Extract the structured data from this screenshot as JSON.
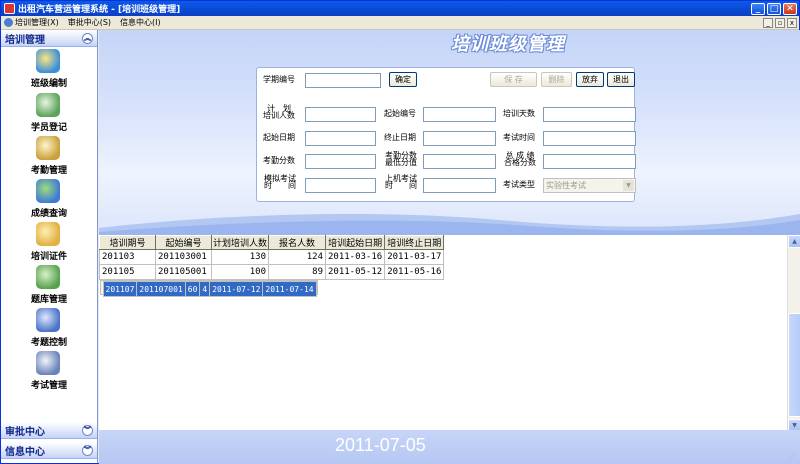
{
  "window": {
    "title": "出租汽车营运管理系统 - [培训班级管理]",
    "buttons": {
      "minimize": "_",
      "maximize": "□",
      "close": "✕"
    }
  },
  "menu": [
    {
      "label": "培训管理(X)"
    },
    {
      "label": "审批中心(S)"
    },
    {
      "label": "信息中心(I)"
    }
  ],
  "nav": {
    "header": "培训管理",
    "items": [
      {
        "label": "班级编制",
        "icon": "class-board-icon",
        "color": "#3b8fd9"
      },
      {
        "label": "学员登记",
        "icon": "student-register-icon",
        "color": "#5aa35a"
      },
      {
        "label": "考勤管理",
        "icon": "attendance-pen-icon",
        "color": "#c9a13c"
      },
      {
        "label": "成绩查询",
        "icon": "score-query-icon",
        "color": "#3e7bd6"
      },
      {
        "label": "培训证件",
        "icon": "certificate-icon",
        "color": "#e0b041"
      },
      {
        "label": "题库管理",
        "icon": "question-bank-icon",
        "color": "#58a24f"
      },
      {
        "label": "考题控制",
        "icon": "exam-control-icon",
        "color": "#4b74c9"
      },
      {
        "label": "考试管理",
        "icon": "exam-manage-icon",
        "color": "#6a84b8"
      }
    ],
    "footer1": "审批中心",
    "footer2": "信息中心"
  },
  "banner": {
    "title": "培训班级管理"
  },
  "form": {
    "term_label": "学期编号",
    "term_value": "",
    "confirm": "确定",
    "save": "保 存",
    "delete": "删除",
    "abandon": "放弃",
    "exit": "退出",
    "plan_count_label": "计　划\n培训人数",
    "start_no_label": "起始编号",
    "train_days_label": "培训天数",
    "start_date_label": "起始日期",
    "end_date_label": "终止日期",
    "exam_time_label": "考试时间",
    "attend_score_label": "考勤分数",
    "attend_min_label": "考勤分数\n最低分值",
    "total_pass_label": "总 成 绩\n合格分数",
    "mock_time_label": "模拟考试\n时　　间",
    "computer_time_label": "上机考试\n时　　间",
    "exam_type_label": "考试类型",
    "exam_type_value": "实验性考试"
  },
  "table": {
    "columns": [
      "培训期号",
      "起始编号",
      "计划培训人数",
      "报名人数",
      "培训起始日期",
      "培训终止日期"
    ],
    "rows": [
      [
        "201103",
        "201103001",
        "130",
        "124",
        "2011-03-16",
        "2011-03-17"
      ],
      [
        "201105",
        "201105001",
        "100",
        "89",
        "2011-05-12",
        "2011-05-16"
      ],
      [
        "201107",
        "201107001",
        "60",
        "4",
        "2011-07-12",
        "2011-07-14"
      ]
    ],
    "selected_row": 2
  },
  "status": {
    "date": "2011-07-05"
  }
}
